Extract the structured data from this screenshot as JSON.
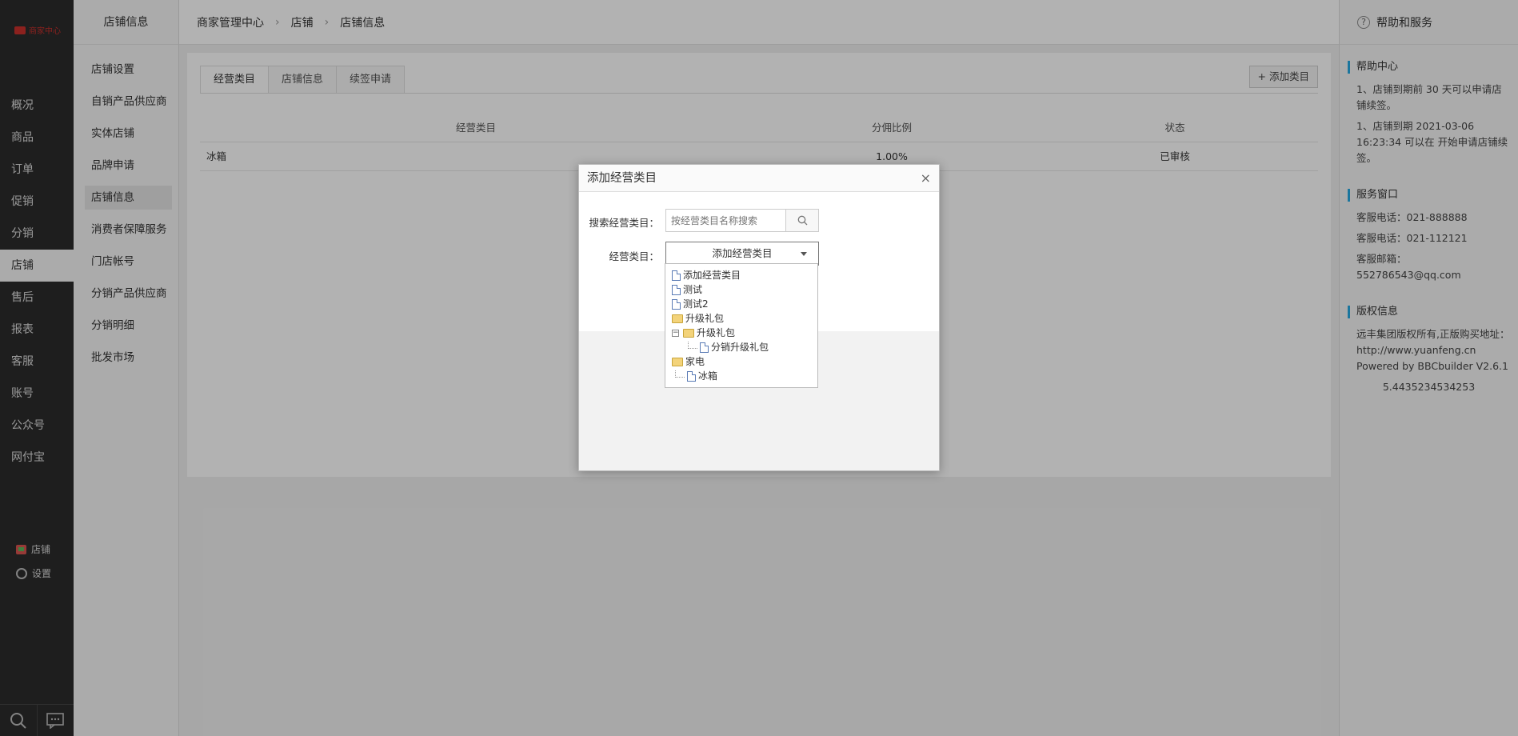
{
  "nav": {
    "logo": "商家中心",
    "items": [
      "概况",
      "商品",
      "订单",
      "促销",
      "分销",
      "店铺",
      "售后",
      "报表",
      "客服",
      "账号",
      "公众号",
      "网付宝"
    ],
    "active_index": 5,
    "bottom_shop": "店铺",
    "bottom_settings": "设置"
  },
  "subnav": {
    "title": "店铺信息",
    "items": [
      "店铺设置",
      "自销产品供应商",
      "实体店铺",
      "品牌申请",
      "店铺信息",
      "消费者保障服务",
      "门店帐号",
      "分销产品供应商",
      "分销明细",
      "批发市场"
    ],
    "active_index": 4
  },
  "breadcrumb": [
    "商家管理中心",
    "店铺",
    "店铺信息"
  ],
  "tabs": [
    "经营类目",
    "店铺信息",
    "续签申请"
  ],
  "add_button": "+ 添加类目",
  "table": {
    "headers": [
      "经营类目",
      "分佣比例",
      "状态"
    ],
    "rows": [
      [
        "冰箱",
        "1.00%",
        "已审核"
      ]
    ]
  },
  "help": {
    "title": "帮助和服务",
    "help_center_title": "帮助中心",
    "help_center_lines": [
      "1、店铺到期前 30 天可以申请店铺续签。",
      "1、店铺到期 2021-03-06 16:23:34 可以在 开始申请店铺续签。"
    ],
    "service_title": "服务窗口",
    "service_lines": [
      "客服电话：021-888888",
      "客服电话：021-112121",
      "客服邮箱：552786543@qq.com"
    ],
    "copyright_title": "版权信息",
    "copyright_text": "远丰集团版权所有,正版购买地址：http://www.yuanfeng.cn Powered by BBCbuilder V2.6.1",
    "version": "5.4435234534253"
  },
  "modal": {
    "title": "添加经营类目",
    "search_label": "搜索经营类目：",
    "search_placeholder": "按经营类目名称搜索",
    "category_label": "经营类目：",
    "category_selected": "添加经营类目",
    "tree": [
      "添加经营类目",
      "测试",
      "测试2",
      "升级礼包",
      "升级礼包",
      "分销升级礼包",
      "家电",
      "冰箱"
    ]
  }
}
